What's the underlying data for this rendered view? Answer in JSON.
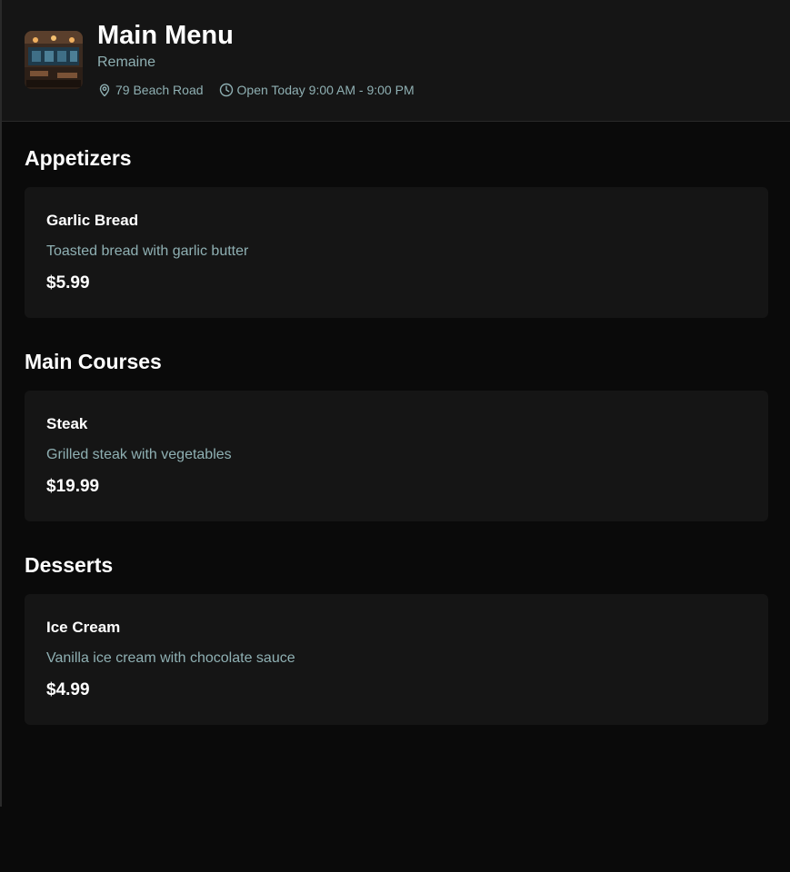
{
  "header": {
    "title": "Main Menu",
    "restaurant_name": "Remaine",
    "address": "79 Beach Road",
    "hours": "Open Today 9:00 AM - 9:00 PM",
    "icons": {
      "address": "map-pin-icon",
      "hours": "clock-icon"
    },
    "logo": "restaurant-interior-photo"
  },
  "sections": [
    {
      "title": "Appetizers",
      "items": [
        {
          "name": "Garlic Bread",
          "description": "Toasted bread with garlic butter",
          "price": "$5.99"
        }
      ]
    },
    {
      "title": "Main Courses",
      "items": [
        {
          "name": "Steak",
          "description": "Grilled steak with vegetables",
          "price": "$19.99"
        }
      ]
    },
    {
      "title": "Desserts",
      "items": [
        {
          "name": "Ice Cream",
          "description": "Vanilla ice cream with chocolate sauce",
          "price": "$4.99"
        }
      ]
    }
  ],
  "colors": {
    "background": "#0a0a0a",
    "card": "#151515",
    "accent_text": "#8fb0b3",
    "text": "#ffffff"
  }
}
